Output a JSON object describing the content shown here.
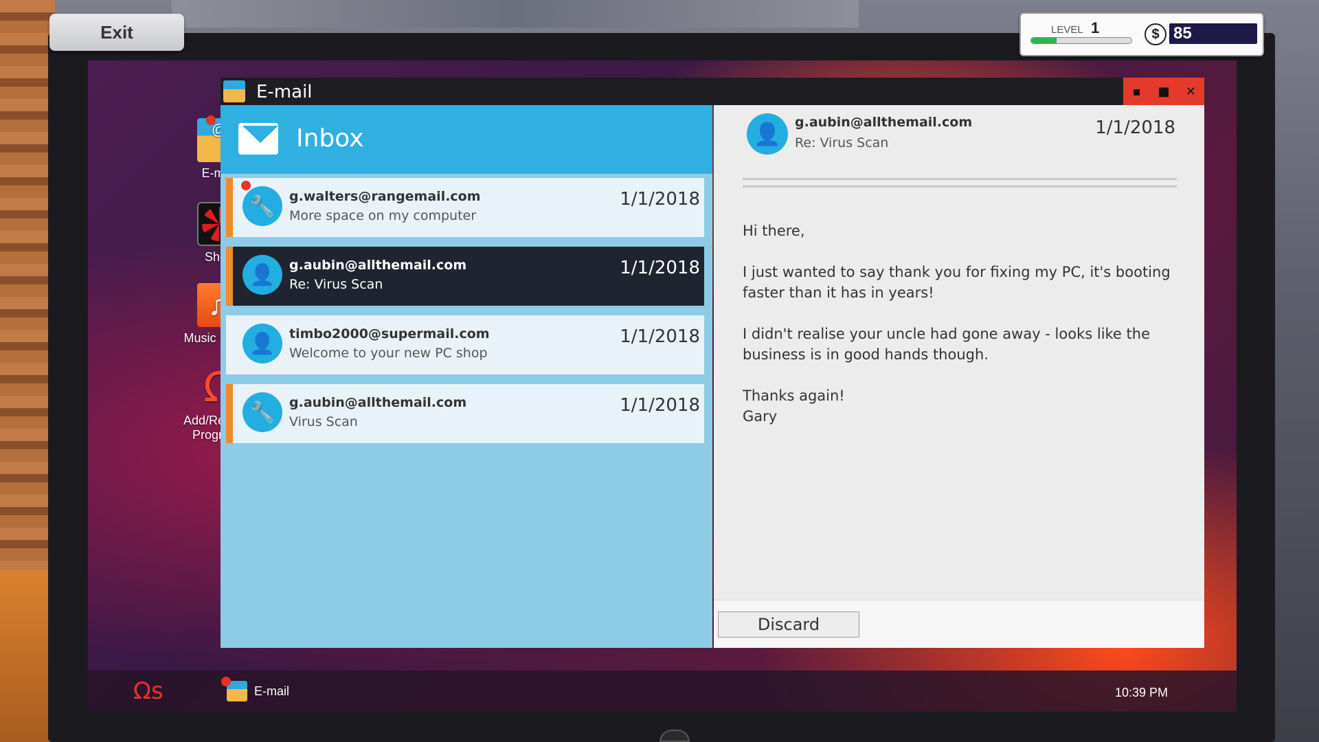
{
  "hud": {
    "exit_label": "Exit",
    "level_label": "LEVEL",
    "level_value": "1",
    "xp_progress": 0.25,
    "currency_symbol": "$",
    "money": "85"
  },
  "desktop": {
    "icons": [
      {
        "label": "E-mail",
        "icon": "email-icon"
      },
      {
        "label": "Shop",
        "icon": "fan-icon"
      },
      {
        "label": "Music Player",
        "icon": "music-note-icon"
      },
      {
        "label": "Add/Remove Programs",
        "icon": "omega-icon"
      }
    ]
  },
  "window": {
    "title": "E-mail",
    "controls": [
      "minimize",
      "maximize",
      "close"
    ]
  },
  "inbox": {
    "title": "Inbox",
    "messages": [
      {
        "from": "g.walters@rangemail.com",
        "subject": "More space on my computer",
        "date": "1/1/2018",
        "icon": "wrench-icon",
        "unread": true
      },
      {
        "from": "g.aubin@allthemail.com",
        "subject": "Re: Virus Scan",
        "date": "1/1/2018",
        "icon": "person-icon",
        "selected": true
      },
      {
        "from": "timbo2000@supermail.com",
        "subject": "Welcome to your new PC shop",
        "date": "1/1/2018",
        "icon": "person-icon"
      },
      {
        "from": "g.aubin@allthemail.com",
        "subject": "Virus Scan",
        "date": "1/1/2018",
        "icon": "wrench-icon"
      }
    ]
  },
  "message": {
    "from": "g.aubin@allthemail.com",
    "subject": "Re: Virus Scan",
    "date": "1/1/2018",
    "body": [
      "Hi there,",
      "I just wanted to say thank you for fixing my PC, it's booting faster than it has in years!",
      "I didn't realise your uncle had gone away - looks like the business is in good hands though.",
      "Thanks again!",
      "Gary"
    ],
    "discard_label": "Discard"
  },
  "taskbar": {
    "task_label": "E-mail",
    "clock": "10:39 PM"
  },
  "colors": {
    "accent_blue": "#2fb0e0",
    "unread_orange": "#f18a2c",
    "close_red": "#e43a2c",
    "notification_red": "#e8322a"
  }
}
